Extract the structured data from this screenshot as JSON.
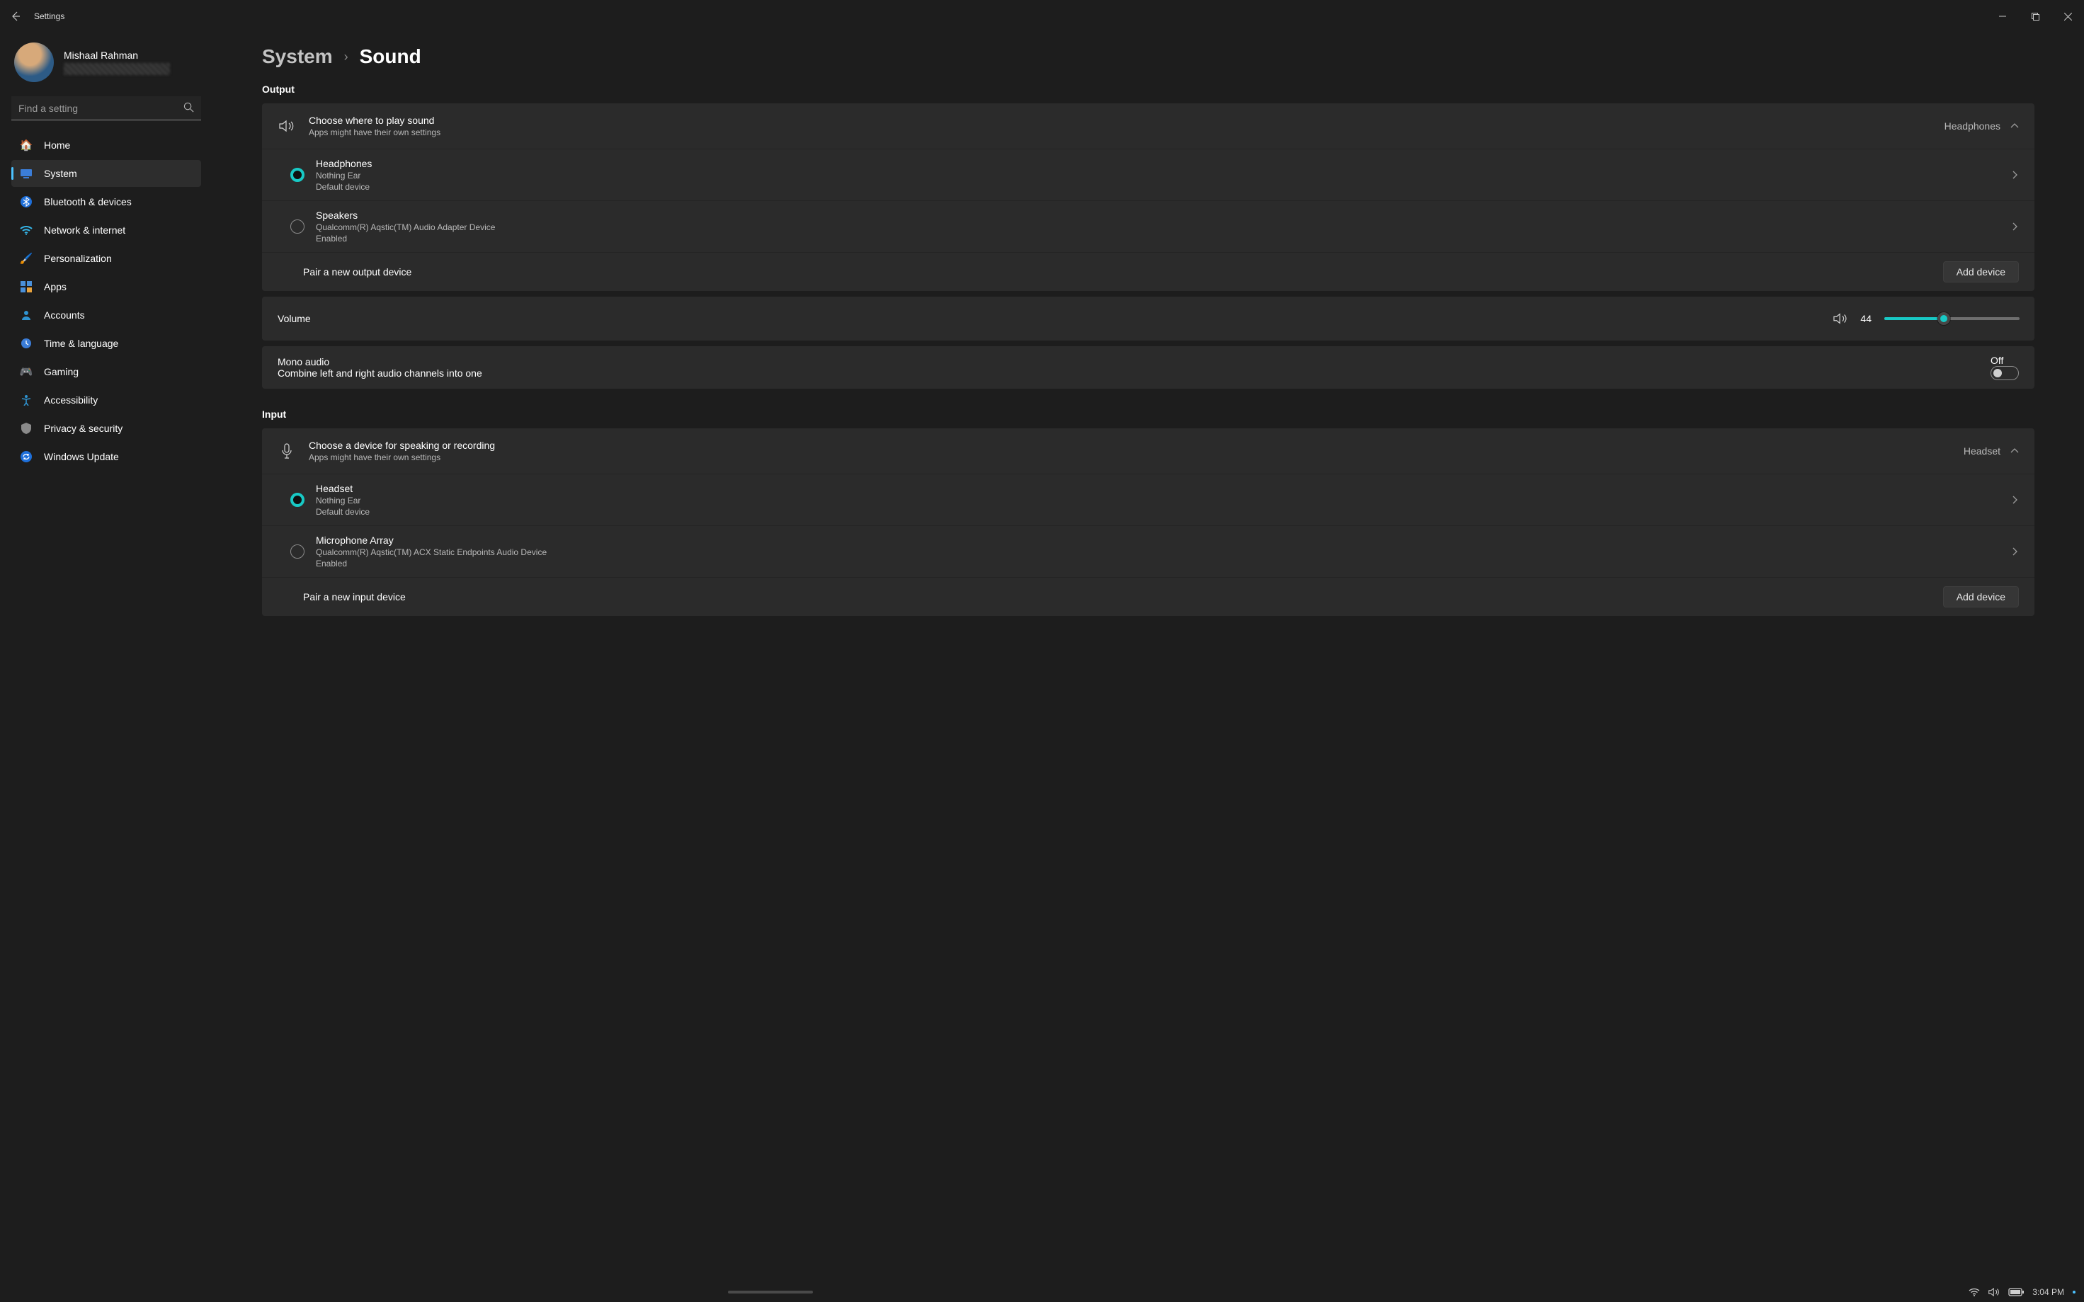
{
  "titlebar": {
    "title": "Settings"
  },
  "profile": {
    "name": "Mishaal Rahman"
  },
  "search": {
    "placeholder": "Find a setting"
  },
  "nav": [
    {
      "label": "Home",
      "icon": "🏠"
    },
    {
      "label": "System",
      "icon": "🖥️",
      "selected": true
    },
    {
      "label": "Bluetooth & devices",
      "icon": "blue"
    },
    {
      "label": "Network & internet",
      "icon": "wifi"
    },
    {
      "label": "Personalization",
      "icon": "🖌️"
    },
    {
      "label": "Apps",
      "icon": "apps"
    },
    {
      "label": "Accounts",
      "icon": "👤"
    },
    {
      "label": "Time & language",
      "icon": "🕒"
    },
    {
      "label": "Gaming",
      "icon": "🎮"
    },
    {
      "label": "Accessibility",
      "icon": "acc"
    },
    {
      "label": "Privacy & security",
      "icon": "🛡️"
    },
    {
      "label": "Windows Update",
      "icon": "🔄"
    }
  ],
  "breadcrumb": {
    "parent": "System",
    "current": "Sound"
  },
  "output": {
    "heading": "Output",
    "choose": {
      "title": "Choose where to play sound",
      "sub": "Apps might have their own settings",
      "value": "Headphones"
    },
    "devices": [
      {
        "name": "Headphones",
        "line2": "Nothing Ear",
        "line3": "Default device",
        "selected": true
      },
      {
        "name": "Speakers",
        "line2": "Qualcomm(R) Aqstic(TM) Audio Adapter Device",
        "line3": "Enabled",
        "selected": false
      }
    ],
    "pair": {
      "label": "Pair a new output device",
      "button": "Add device"
    },
    "volume": {
      "label": "Volume",
      "value": "44",
      "percent": 44
    },
    "mono": {
      "title": "Mono audio",
      "sub": "Combine left and right audio channels into one",
      "state": "Off"
    }
  },
  "input": {
    "heading": "Input",
    "choose": {
      "title": "Choose a device for speaking or recording",
      "sub": "Apps might have their own settings",
      "value": "Headset"
    },
    "devices": [
      {
        "name": "Headset",
        "line2": "Nothing Ear",
        "line3": "Default device",
        "selected": true
      },
      {
        "name": "Microphone Array",
        "line2": "Qualcomm(R) Aqstic(TM) ACX Static Endpoints Audio Device",
        "line3": "Enabled",
        "selected": false
      }
    ],
    "pair": {
      "label": "Pair a new input device",
      "button": "Add device"
    }
  },
  "taskbar": {
    "time": "3:04 PM"
  }
}
